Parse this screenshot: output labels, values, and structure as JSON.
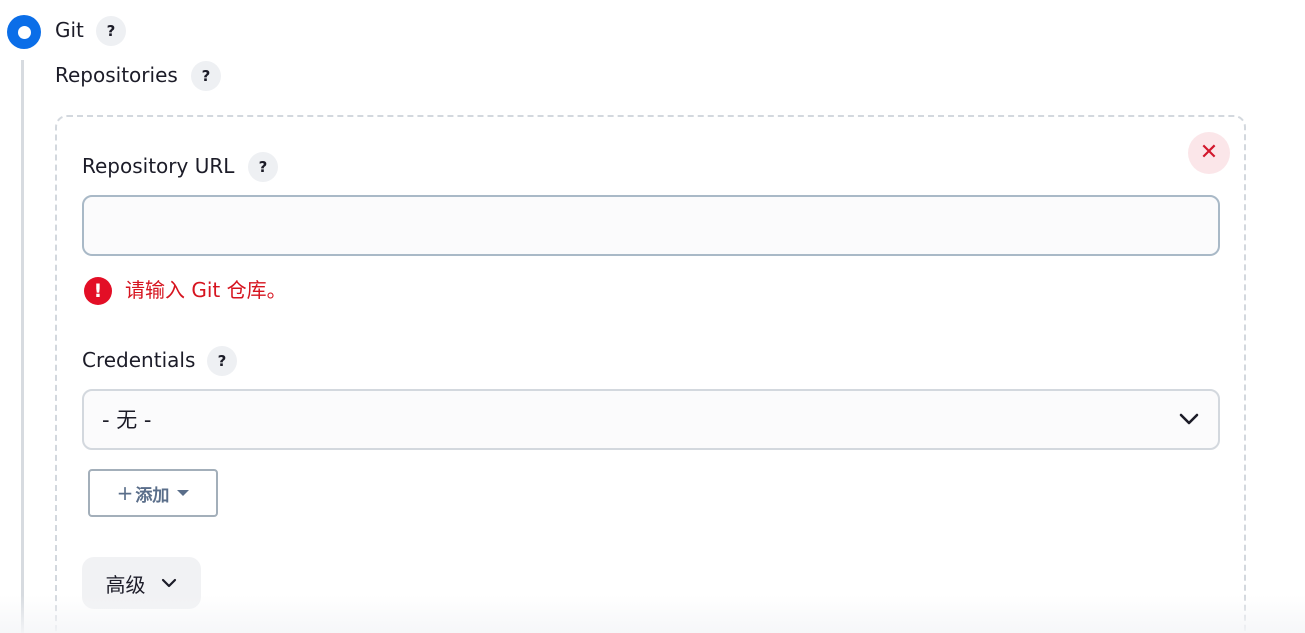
{
  "scm": {
    "option_label": "Git",
    "selected": true,
    "help_glyph": "?"
  },
  "repositories": {
    "label": "Repositories",
    "close_glyph": "✕",
    "repo_url": {
      "label": "Repository URL",
      "value": "",
      "placeholder": "",
      "error_glyph": "!",
      "error_message": "请输入 Git 仓库。"
    },
    "credentials": {
      "label": "Credentials",
      "selected_value": "- 无 -"
    },
    "add_button": {
      "plus": "+",
      "label": "添加"
    },
    "advanced_button": {
      "label": "高级"
    }
  },
  "colors": {
    "accent": "#0b6ee8",
    "error": "#e30e26",
    "close_bg": "#fbe6e9"
  },
  "icons": [
    "radio-selected-icon",
    "help-icon",
    "close-icon",
    "error-icon",
    "chevron-down-icon",
    "caret-down-icon"
  ]
}
